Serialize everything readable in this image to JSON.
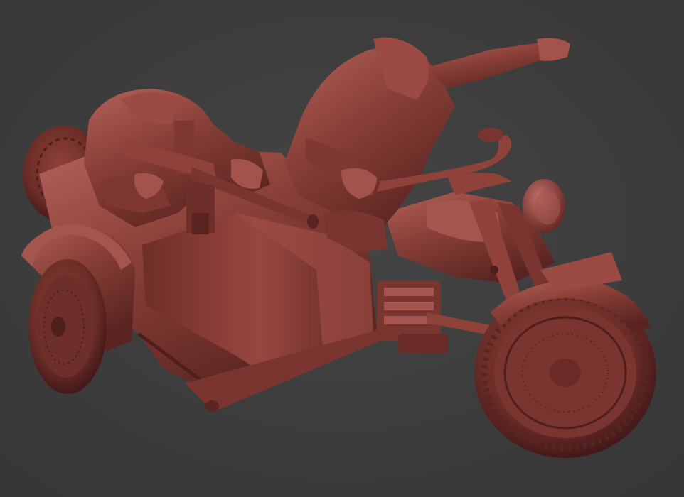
{
  "scene": {
    "subject": "sculpted-motorcycle-with-sidecar-and-two-figures",
    "colors": {
      "background": "#3a3a3a",
      "background_center": "#444444",
      "model_base": "#8a4038",
      "model_light": "#b4625a",
      "model_mid": "#7a3530",
      "model_dark": "#4e1f1b",
      "model_shadow": "#34130f"
    }
  }
}
